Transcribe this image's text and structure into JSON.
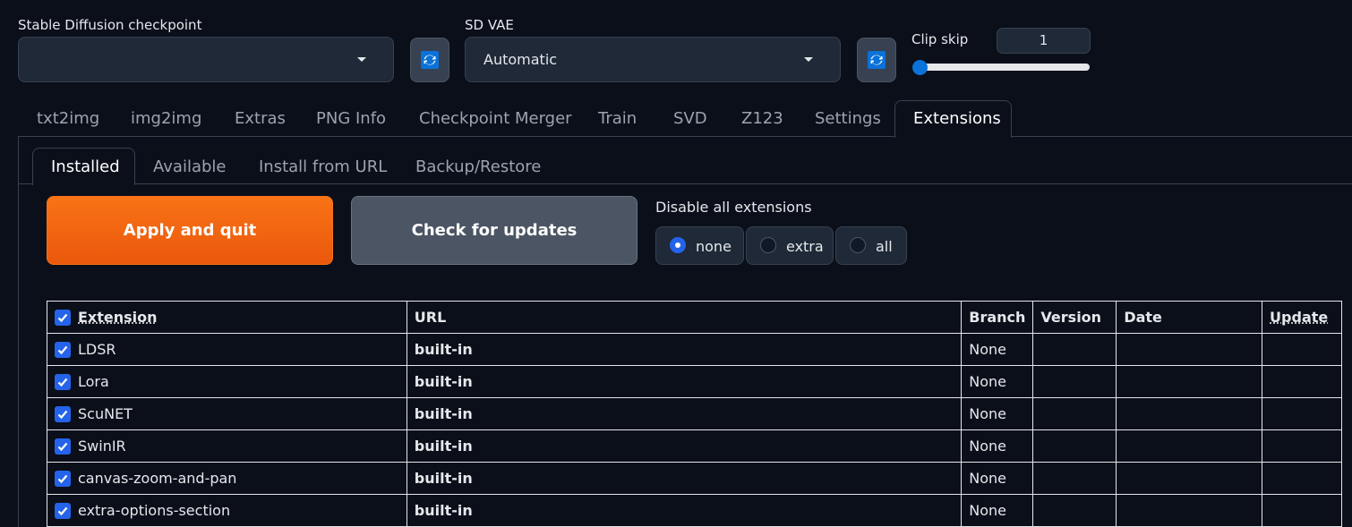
{
  "header": {
    "checkpoint_label": "Stable Diffusion checkpoint",
    "checkpoint_value": "",
    "vae_label": "SD VAE",
    "vae_value": "Automatic",
    "clip_skip_label": "Clip skip",
    "clip_skip_value": "1"
  },
  "main_tabs": [
    "txt2img",
    "img2img",
    "Extras",
    "PNG Info",
    "Checkpoint Merger",
    "Train",
    "SVD",
    "Z123",
    "Settings",
    "Extensions"
  ],
  "active_main_tab": "Extensions",
  "sub_tabs": [
    "Installed",
    "Available",
    "Install from URL",
    "Backup/Restore"
  ],
  "active_sub_tab": "Installed",
  "buttons": {
    "apply": "Apply and quit",
    "check": "Check for updates"
  },
  "disable": {
    "label": "Disable all extensions",
    "options": [
      "none",
      "extra",
      "all"
    ],
    "selected": "none"
  },
  "table": {
    "headers": [
      "Extension",
      "URL",
      "Branch",
      "Version",
      "Date",
      "Update"
    ],
    "rows": [
      {
        "name": "LDSR",
        "url": "built-in",
        "branch": "None",
        "version": "",
        "date": "",
        "update": ""
      },
      {
        "name": "Lora",
        "url": "built-in",
        "branch": "None",
        "version": "",
        "date": "",
        "update": ""
      },
      {
        "name": "ScuNET",
        "url": "built-in",
        "branch": "None",
        "version": "",
        "date": "",
        "update": ""
      },
      {
        "name": "SwinIR",
        "url": "built-in",
        "branch": "None",
        "version": "",
        "date": "",
        "update": ""
      },
      {
        "name": "canvas-zoom-and-pan",
        "url": "built-in",
        "branch": "None",
        "version": "",
        "date": "",
        "update": ""
      },
      {
        "name": "extra-options-section",
        "url": "built-in",
        "branch": "None",
        "version": "",
        "date": "",
        "update": ""
      }
    ]
  },
  "colors": {
    "background": "#0b0f19",
    "accent_orange": "#f97316",
    "accent_blue": "#2563eb"
  },
  "icons": [
    "refresh-icon",
    "chevron-down-icon",
    "checkbox-checked-icon"
  ]
}
